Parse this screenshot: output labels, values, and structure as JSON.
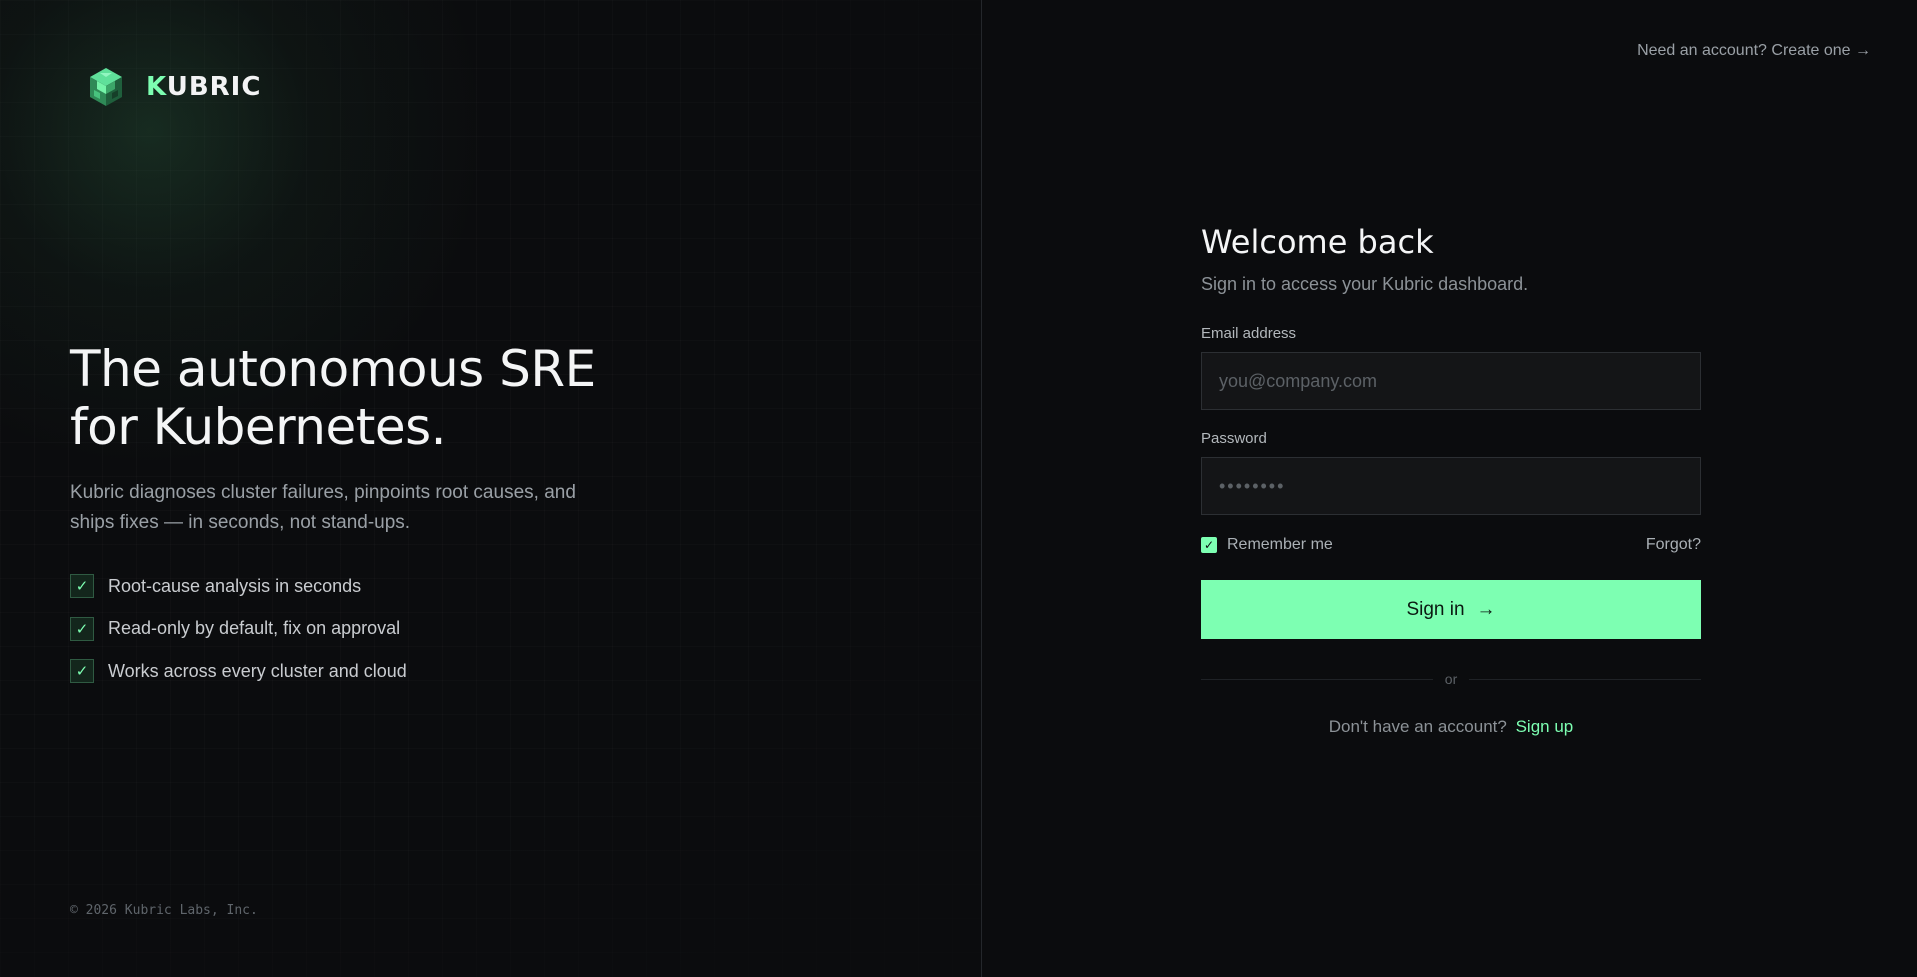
{
  "brand": {
    "logo_icon": "cube-logo-icon",
    "name_first": "K",
    "name_rest": "UBRIC",
    "accent_color": "#7dffb2"
  },
  "hero": {
    "title_line1": "The autonomous SRE",
    "title_line2": "for Kubernetes.",
    "subtitle": "Kubric diagnoses cluster failures, pinpoints root causes, and ships fixes — in seconds, not stand-ups.",
    "features": [
      {
        "icon": "check-icon",
        "label": "Root-cause analysis in seconds"
      },
      {
        "icon": "check-icon",
        "label": "Read-only by default, fix on approval"
      },
      {
        "icon": "check-icon",
        "label": "Works across every cluster and cloud"
      }
    ]
  },
  "footer": {
    "copyright": "© 2026 Kubric Labs, Inc."
  },
  "top_nav": {
    "create_account_link": "Need an account? Create one →"
  },
  "form": {
    "title": "Welcome back",
    "subtitle": "Sign in to access your Kubric dashboard.",
    "email_label": "Email address",
    "email_placeholder": "you@company.com",
    "email_value": "",
    "password_label": "Password",
    "password_placeholder": "••••••••",
    "password_value": "",
    "remember_label": "Remember me",
    "remember_checked": true,
    "forgot_label": "Forgot?",
    "signin_label": "Sign in",
    "signin_arrow": "→",
    "divider_text": "or",
    "signup_prompt": "Don't have an account?",
    "signup_link": "Sign up"
  }
}
